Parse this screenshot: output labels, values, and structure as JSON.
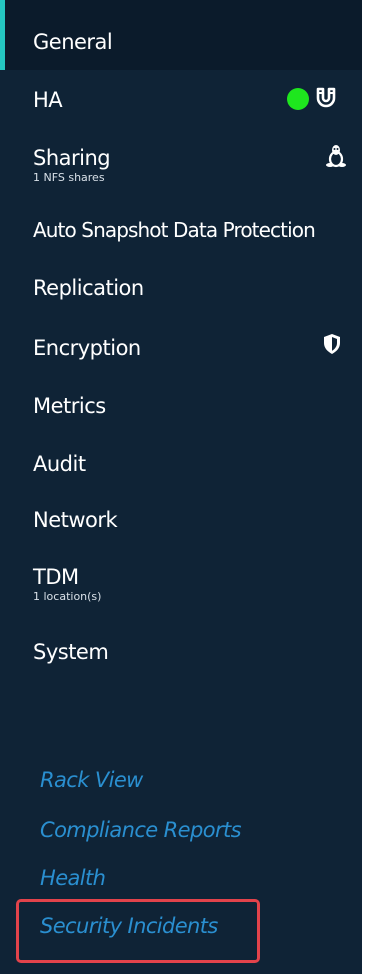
{
  "sidebar": {
    "items": [
      {
        "label": "General",
        "active": true
      },
      {
        "label": "HA",
        "status_color": "#1ee61e",
        "icon": "ha-magnet-icon"
      },
      {
        "label": "Sharing",
        "sub": "1 NFS shares",
        "icon": "linux-tux-icon"
      },
      {
        "label": "Auto Snapshot Data Protection"
      },
      {
        "label": "Replication"
      },
      {
        "label": "Encryption",
        "icon": "shield-icon"
      },
      {
        "label": "Metrics"
      },
      {
        "label": "Audit"
      },
      {
        "label": "Network"
      },
      {
        "label": "TDM",
        "sub": "1 location(s)"
      },
      {
        "label": "System"
      }
    ],
    "links": [
      {
        "label": "Rack View"
      },
      {
        "label": "Compliance Reports"
      },
      {
        "label": "Health"
      },
      {
        "label": "Security Incidents",
        "highlighted": true
      }
    ],
    "colors": {
      "background": "#0f2336",
      "active_indicator": "#25c7c2",
      "link": "#2a8fd0",
      "highlight_border": "#e2434b"
    }
  }
}
